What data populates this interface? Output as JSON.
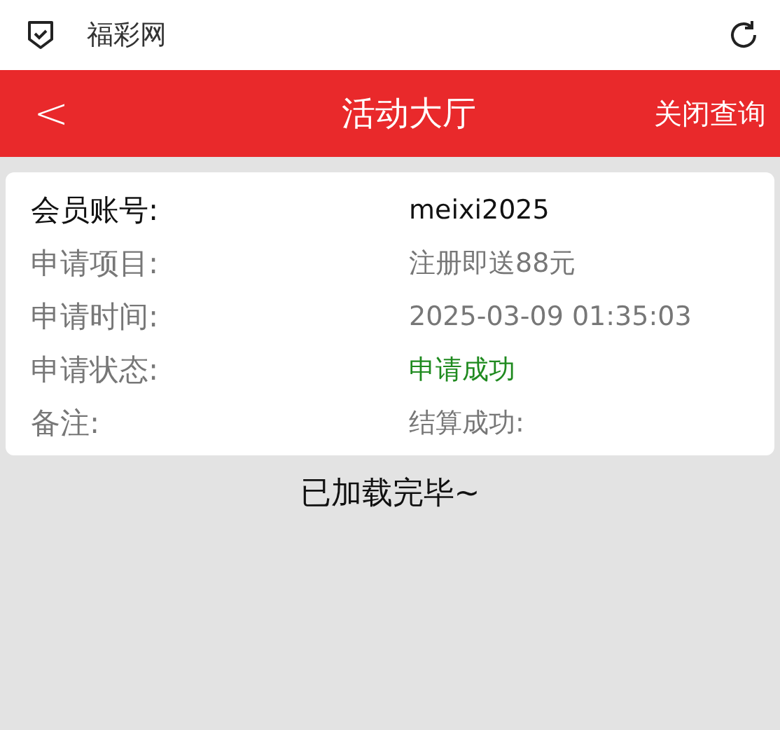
{
  "browser_bar": {
    "title": "福彩网"
  },
  "header": {
    "back": "<",
    "title": "活动大厅",
    "action": "关闭查询"
  },
  "details": [
    {
      "label": "会员账号:",
      "value": "meixi2025",
      "kind": "primary"
    },
    {
      "label": "申请项目:",
      "value": "注册即送88元",
      "kind": "normal"
    },
    {
      "label": "申请时间:",
      "value": "2025-03-09 01:35:03",
      "kind": "normal"
    },
    {
      "label": "申请状态:",
      "value": "申请成功",
      "kind": "success"
    },
    {
      "label": "备注:",
      "value": "结算成功:",
      "kind": "normal"
    }
  ],
  "footer_text": "已加载完毕~"
}
